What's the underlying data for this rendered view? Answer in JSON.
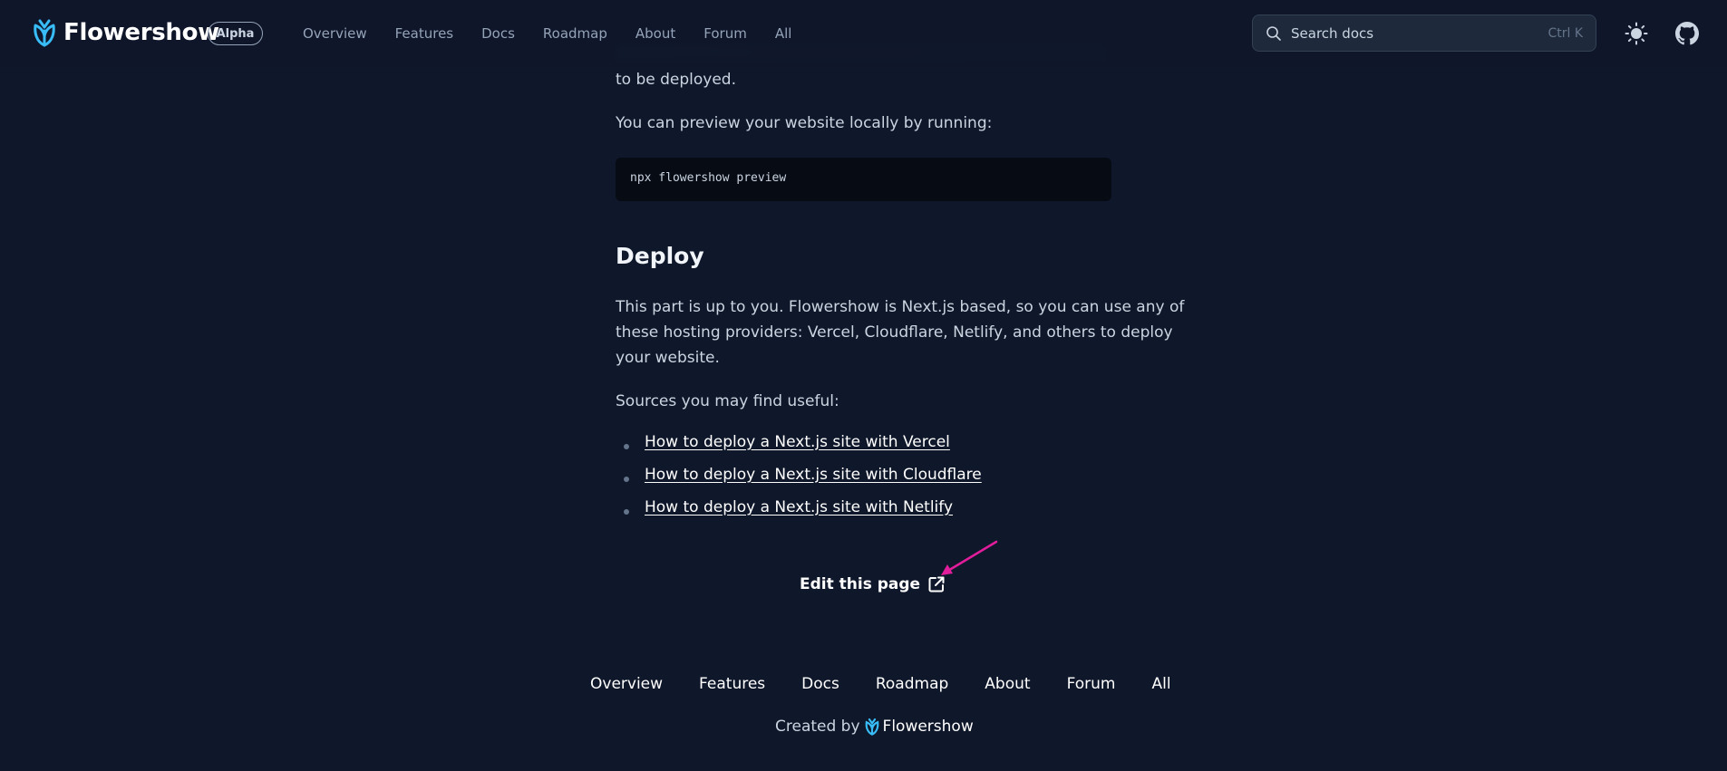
{
  "header": {
    "brand": "Flowershow",
    "badge": "Alpha",
    "nav": [
      "Overview",
      "Features",
      "Docs",
      "Roadmap",
      "About",
      "Forum",
      "All"
    ],
    "search": {
      "placeholder": "Search docs",
      "shortcut": "Ctrl K"
    },
    "icons": {
      "theme": "sun-icon",
      "github": "github-icon"
    }
  },
  "content": {
    "fragment_end": "to be deployed.",
    "preview_text": "You can preview your website locally by running:",
    "code": "npx flowershow preview",
    "deploy_heading": "Deploy",
    "deploy_paragraph_line1": "This part is up to you. Flowershow is Next.js based, so you can use any of",
    "deploy_paragraph_line2": "these hosting providers: Vercel, Cloudflare, Netlify, and others to deploy",
    "deploy_paragraph_line3": "your website.",
    "sources_text": "Sources you may find useful:",
    "links": [
      "How to deploy a Next.js site with Vercel",
      "How to deploy a Next.js site with Cloudflare",
      "How to deploy a Next.js site with Netlify"
    ],
    "edit_label": "Edit this page"
  },
  "footer": {
    "nav": [
      "Overview",
      "Features",
      "Docs",
      "Roadmap",
      "About",
      "Forum",
      "All"
    ],
    "credit_prefix": "Created by",
    "credit_brand": "Flowershow"
  },
  "colors": {
    "background": "#0f172a",
    "accent": "#38bdf8",
    "annotation_arrow": "#e11d9b"
  }
}
